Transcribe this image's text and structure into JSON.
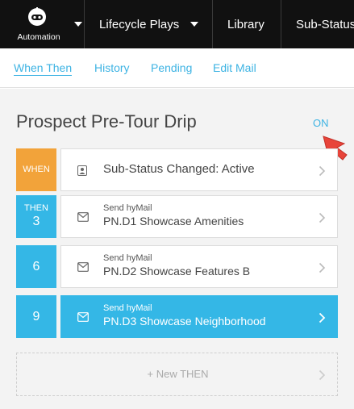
{
  "nav": {
    "app_label": "Automation",
    "items": [
      {
        "label": "Lifecycle Plays"
      },
      {
        "label": "Library"
      },
      {
        "label": "Sub-Status"
      }
    ]
  },
  "tabs": [
    {
      "label": "When Then",
      "active": true
    },
    {
      "label": "History",
      "active": false
    },
    {
      "label": "Pending",
      "active": false
    },
    {
      "label": "Edit Mail",
      "active": false
    }
  ],
  "play": {
    "title": "Prospect Pre-Tour Drip",
    "status": "ON"
  },
  "when": {
    "badge": "WHEN",
    "text": "Sub-Status Changed: Active"
  },
  "steps": [
    {
      "badge_label": "THEN",
      "day": "3",
      "type": "Send hyMail",
      "name": "PN.D1 Showcase Amenities",
      "active": false
    },
    {
      "badge_label": "",
      "day": "6",
      "type": "Send hyMail",
      "name": "PN.D2 Showcase Features B",
      "active": false
    },
    {
      "badge_label": "",
      "day": "9",
      "type": "Send hyMail",
      "name": "PN.D3 Showcase Neighborhood",
      "active": true
    }
  ],
  "new_then": "+ New THEN",
  "colors": {
    "nav_bg": "#111111",
    "accent": "#34b7e6",
    "when_badge": "#f2a33a",
    "cursor": "#e8443a"
  }
}
